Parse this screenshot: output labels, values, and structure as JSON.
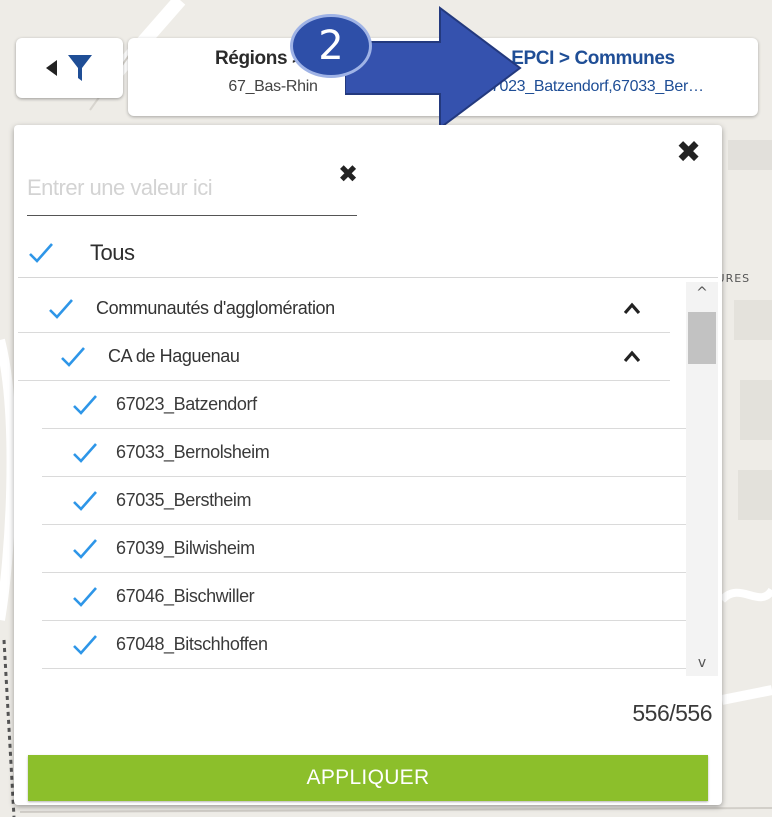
{
  "map": {
    "street_label": "AURES"
  },
  "breadcrumb": {
    "left": {
      "title": "Régions > Dé",
      "value": "67_Bas-Rhin"
    },
    "right": {
      "title": "EPCI > Communes",
      "value": "67023_Batzendorf,67033_Ber…"
    }
  },
  "annotation": {
    "step_number": "2"
  },
  "search": {
    "placeholder": "Entrer une valeur ici",
    "value": ""
  },
  "select_all": {
    "label": "Tous",
    "checked": true
  },
  "groups": [
    {
      "label": "Communautés d'agglomération",
      "expanded": true,
      "checked": true
    },
    {
      "label": "CA de Haguenau",
      "expanded": true,
      "checked": true
    }
  ],
  "items": [
    {
      "label": "67023_Batzendorf",
      "checked": true
    },
    {
      "label": "67033_Bernolsheim",
      "checked": true
    },
    {
      "label": "67035_Berstheim",
      "checked": true
    },
    {
      "label": "67039_Bilwisheim",
      "checked": true
    },
    {
      "label": "67046_Bischwiller",
      "checked": true
    },
    {
      "label": "67048_Bitschhoffen",
      "checked": true
    }
  ],
  "count": "556/556",
  "apply_label": "APPLIQUER",
  "colors": {
    "check": "#2e96e8",
    "apply": "#8cbf2b",
    "link": "#1f4e96",
    "badge": "#2e4fa8"
  }
}
